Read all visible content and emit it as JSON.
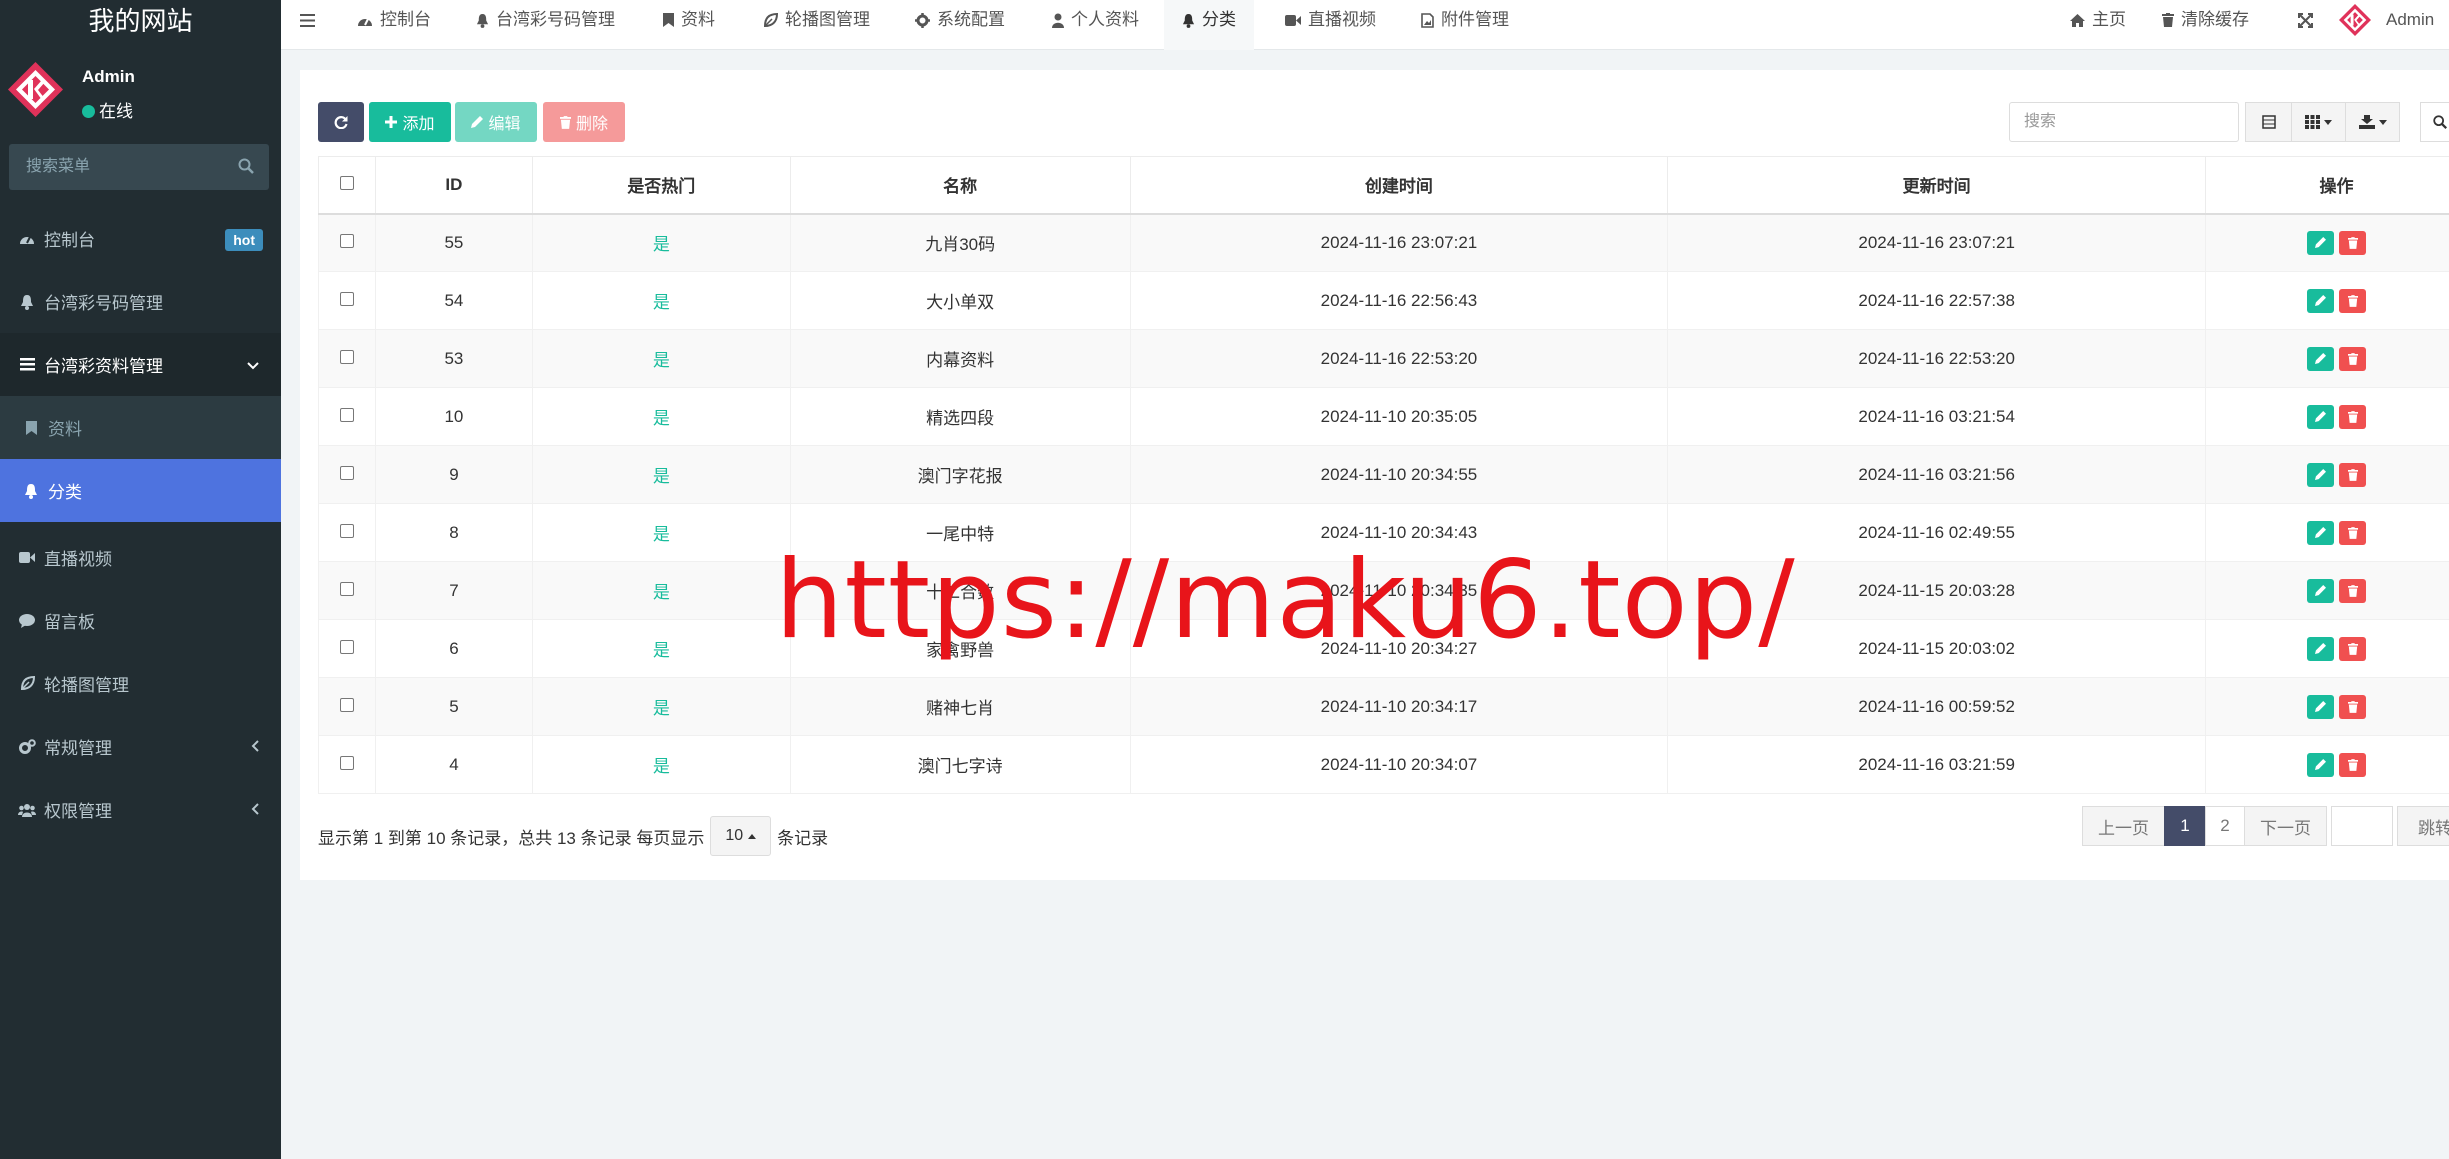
{
  "sidebar": {
    "site_title": "我的网站",
    "user": {
      "name": "Admin",
      "status": "在线"
    },
    "search_placeholder": "搜索菜单",
    "items": [
      {
        "label": "控制台",
        "icon": "dashboard-icon",
        "badge": "hot"
      },
      {
        "label": "台湾彩号码管理",
        "icon": "bell-icon"
      },
      {
        "label": "台湾彩资料管理",
        "icon": "list-icon"
      },
      {
        "label": "资料",
        "icon": "bookmark-icon"
      },
      {
        "label": "分类",
        "icon": "bell-icon"
      },
      {
        "label": "直播视频",
        "icon": "video-icon"
      },
      {
        "label": "留言板",
        "icon": "comment-icon"
      },
      {
        "label": "轮播图管理",
        "icon": "leaf-icon"
      },
      {
        "label": "常规管理",
        "icon": "cogs-icon"
      },
      {
        "label": "权限管理",
        "icon": "users-icon"
      }
    ]
  },
  "topnav": {
    "tabs": [
      {
        "label": "控制台",
        "icon": "dashboard-icon"
      },
      {
        "label": "台湾彩号码管理",
        "icon": "bell-icon"
      },
      {
        "label": "资料",
        "icon": "bookmark-icon"
      },
      {
        "label": "轮播图管理",
        "icon": "leaf-icon"
      },
      {
        "label": "系统配置",
        "icon": "gear-icon"
      },
      {
        "label": "个人资料",
        "icon": "user-icon"
      },
      {
        "label": "分类",
        "icon": "bell-icon"
      },
      {
        "label": "直播视频",
        "icon": "video-icon"
      },
      {
        "label": "附件管理",
        "icon": "file-image-icon"
      }
    ],
    "right": {
      "home": "主页",
      "clear_cache": "清除缓存",
      "user": "Admin"
    }
  },
  "toolbar": {
    "add": "添加",
    "edit": "编辑",
    "delete": "删除",
    "search_placeholder": "搜索"
  },
  "table": {
    "headers": [
      "ID",
      "是否热门",
      "名称",
      "创建时间",
      "更新时间",
      "操作"
    ],
    "rows": [
      {
        "id": "55",
        "hot": "是",
        "name": "九肖30码",
        "created": "2024-11-16 23:07:21",
        "updated": "2024-11-16 23:07:21"
      },
      {
        "id": "54",
        "hot": "是",
        "name": "大小单双",
        "created": "2024-11-16 22:56:43",
        "updated": "2024-11-16 22:57:38"
      },
      {
        "id": "53",
        "hot": "是",
        "name": "内幕资料",
        "created": "2024-11-16 22:53:20",
        "updated": "2024-11-16 22:53:20"
      },
      {
        "id": "10",
        "hot": "是",
        "name": "精选四段",
        "created": "2024-11-10 20:35:05",
        "updated": "2024-11-16 03:21:54"
      },
      {
        "id": "9",
        "hot": "是",
        "name": "澳门字花报",
        "created": "2024-11-10 20:34:55",
        "updated": "2024-11-16 03:21:56"
      },
      {
        "id": "8",
        "hot": "是",
        "name": "一尾中特",
        "created": "2024-11-10 20:34:43",
        "updated": "2024-11-16 02:49:55"
      },
      {
        "id": "7",
        "hot": "是",
        "name": "十二合数",
        "created": "2024-11-10 20:34:35",
        "updated": "2024-11-15 20:03:28"
      },
      {
        "id": "6",
        "hot": "是",
        "name": "家禽野兽",
        "created": "2024-11-10 20:34:27",
        "updated": "2024-11-15 20:03:02"
      },
      {
        "id": "5",
        "hot": "是",
        "name": "赌神七肖",
        "created": "2024-11-10 20:34:17",
        "updated": "2024-11-16 00:59:52"
      },
      {
        "id": "4",
        "hot": "是",
        "name": "澳门七字诗",
        "created": "2024-11-10 20:34:07",
        "updated": "2024-11-16 03:21:59"
      }
    ]
  },
  "footer": {
    "info": "显示第 1 到第 10 条记录，总共 13 条记录 每页显示",
    "page_size": "10",
    "suffix": "条记录",
    "prev": "上一页",
    "pages": [
      "1",
      "2"
    ],
    "next": "下一页",
    "jump": "跳转"
  },
  "watermark": "https://maku6.top/",
  "colors": {
    "sidebar": "#222d32",
    "active": "#4e73df",
    "green": "#18bc9c",
    "red": "#f05050",
    "dark": "#444c69"
  }
}
